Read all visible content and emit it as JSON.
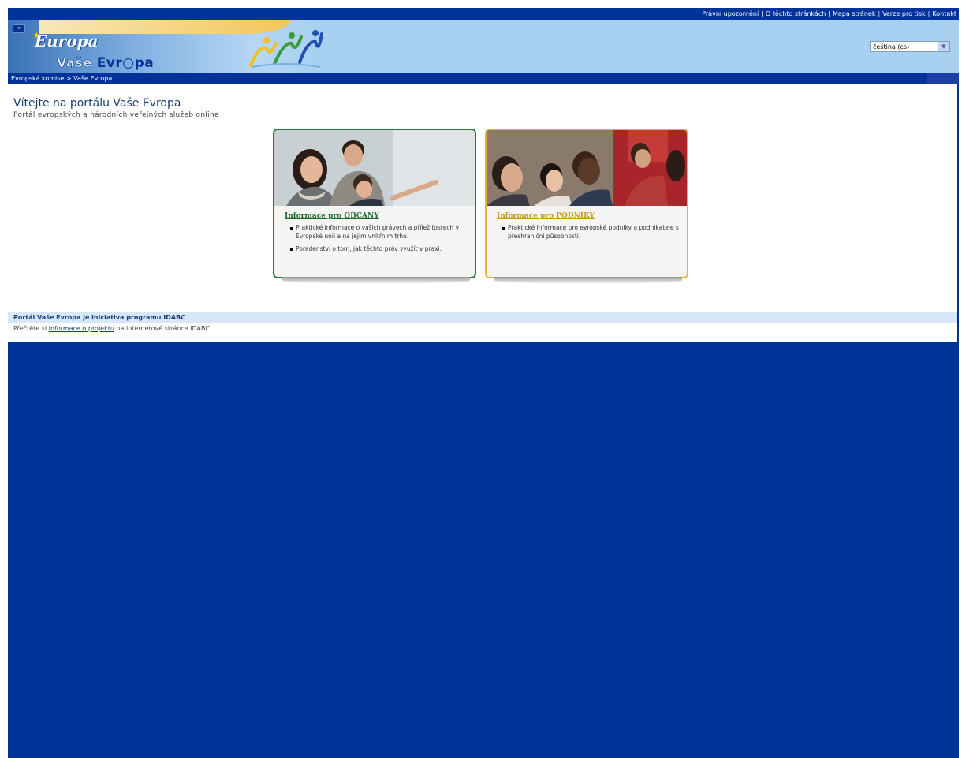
{
  "util_nav": {
    "items": [
      "Právní upozornění",
      "O těchto stránkách",
      "Mapa stránek",
      "Verze pro tisk",
      "Kontakt"
    ],
    "separator": "|"
  },
  "banner": {
    "logo_europa": "Europa",
    "logo_vase": "Vaše",
    "logo_evropa": "Evr○pa",
    "flag_icon": "eu-flag-icon",
    "figures_icon": "people-figures-icon"
  },
  "language": {
    "selected": "čeština (cs)",
    "arrow_icon": "chevron-down-icon"
  },
  "breadcrumb": {
    "root": "Evropská komise",
    "separator": ">",
    "current": "Vaše Evropa"
  },
  "main": {
    "title": "Vítejte na portálu Vaše Evropa",
    "subtitle": "Portál evropských a národních veřejných služeb online"
  },
  "cards": {
    "citizens": {
      "title": "Informace pro OBČANY",
      "bullets": [
        "Praktické informace o vašich právech a příležitostech v Evropské unii a na jejím vnitřním trhu.",
        "Poradenství o tom, jak těchto práv využít v praxi."
      ],
      "border_color": "#2c7a38"
    },
    "business": {
      "title": "Informace pro PODNIKY",
      "bullets": [
        "Praktické informace pro evropské podniky a podnikatele s přeshraniční působností."
      ],
      "border_color": "#e3b43a"
    }
  },
  "footer": {
    "title": "Portál Vaše Evropa je iniciativa programu IDABC",
    "text_before": "Přečtěte si",
    "link": "informace o projektu",
    "text_after": "na internetové stránce IDABC"
  },
  "colors": {
    "frame": "#003399",
    "banner": "#a8d0f0"
  }
}
